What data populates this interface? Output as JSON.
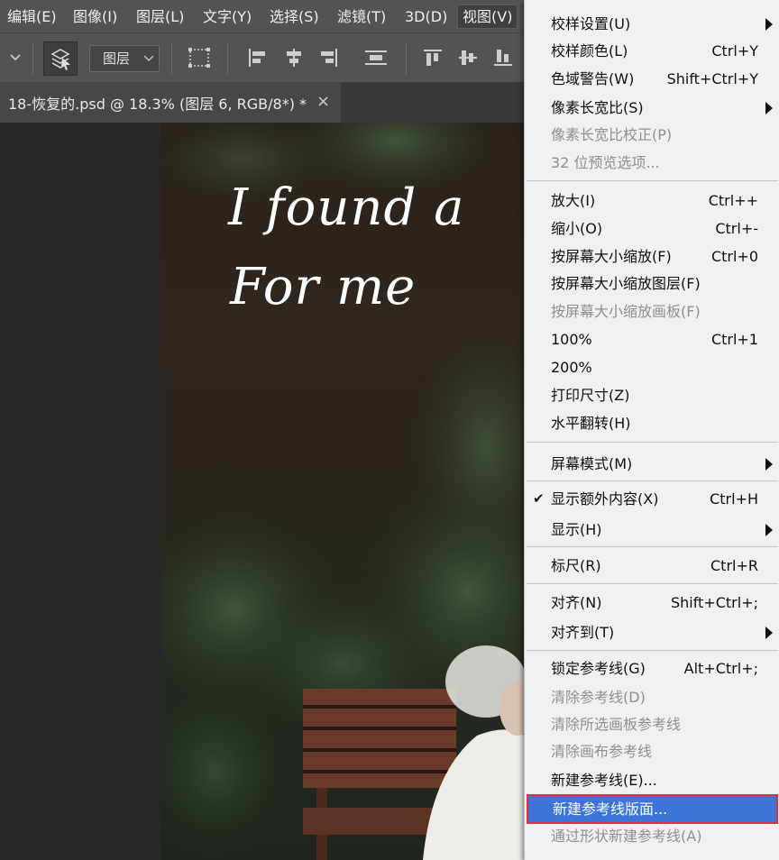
{
  "menubar": {
    "items": [
      "编辑(E)",
      "图像(I)",
      "图层(L)",
      "文字(Y)",
      "选择(S)",
      "滤镜(T)",
      "3D(D)",
      "视图(V)"
    ]
  },
  "toolbar": {
    "dropdown_value": "图层"
  },
  "document_tab": {
    "title": "18-恢复的.psd @ 18.3% (图层 6, RGB/8*) *",
    "close": "×"
  },
  "canvas": {
    "text_line1": "I found a",
    "text_line2": "For me"
  },
  "view_menu": {
    "items": [
      {
        "label": "校样设置(U)",
        "shortcut": "",
        "submenu": true,
        "disabled": false
      },
      {
        "label": "校样颜色(L)",
        "shortcut": "Ctrl+Y",
        "disabled": false
      },
      {
        "label": "色域警告(W)",
        "shortcut": "Shift+Ctrl+Y",
        "disabled": false
      },
      {
        "label": "像素长宽比(S)",
        "shortcut": "",
        "submenu": true,
        "disabled": false
      },
      {
        "label": "像素长宽比校正(P)",
        "shortcut": "",
        "disabled": true
      },
      {
        "label": "32 位预览选项...",
        "shortcut": "",
        "disabled": true
      },
      {
        "label": "放大(I)",
        "shortcut": "Ctrl++",
        "disabled": false
      },
      {
        "label": "缩小(O)",
        "shortcut": "Ctrl+-",
        "disabled": false
      },
      {
        "label": "按屏幕大小缩放(F)",
        "shortcut": "Ctrl+0",
        "disabled": false
      },
      {
        "label": "按屏幕大小缩放图层(F)",
        "shortcut": "",
        "disabled": false
      },
      {
        "label": "按屏幕大小缩放画板(F)",
        "shortcut": "",
        "disabled": true
      },
      {
        "label": "100%",
        "shortcut": "Ctrl+1",
        "disabled": false
      },
      {
        "label": "200%",
        "shortcut": "",
        "disabled": false
      },
      {
        "label": "打印尺寸(Z)",
        "shortcut": "",
        "disabled": false
      },
      {
        "label": "水平翻转(H)",
        "shortcut": "",
        "disabled": false
      },
      {
        "label": "屏幕模式(M)",
        "shortcut": "",
        "submenu": true,
        "disabled": false
      },
      {
        "label": "显示额外内容(X)",
        "shortcut": "Ctrl+H",
        "checked": true,
        "disabled": false
      },
      {
        "label": "显示(H)",
        "shortcut": "",
        "submenu": true,
        "disabled": false
      },
      {
        "label": "标尺(R)",
        "shortcut": "Ctrl+R",
        "disabled": false
      },
      {
        "label": "对齐(N)",
        "shortcut": "Shift+Ctrl+;",
        "disabled": false
      },
      {
        "label": "对齐到(T)",
        "shortcut": "",
        "submenu": true,
        "disabled": false
      },
      {
        "label": "锁定参考线(G)",
        "shortcut": "Alt+Ctrl+;",
        "disabled": false
      },
      {
        "label": "清除参考线(D)",
        "shortcut": "",
        "disabled": true
      },
      {
        "label": "清除所选画板参考线",
        "shortcut": "",
        "disabled": true
      },
      {
        "label": "清除画布参考线",
        "shortcut": "",
        "disabled": true
      },
      {
        "label": "新建参考线(E)...",
        "shortcut": "",
        "disabled": false
      },
      {
        "label": "新建参考线版面...",
        "shortcut": "",
        "disabled": false,
        "highlighted": true
      },
      {
        "label": "通过形状新建参考线(A)",
        "shortcut": "",
        "disabled": true
      }
    ]
  },
  "colors": {
    "highlight": "#3c74d8",
    "highlight_border": "#d8333f",
    "menu_bg": "#f0f0f0",
    "app_bg": "#535353"
  }
}
